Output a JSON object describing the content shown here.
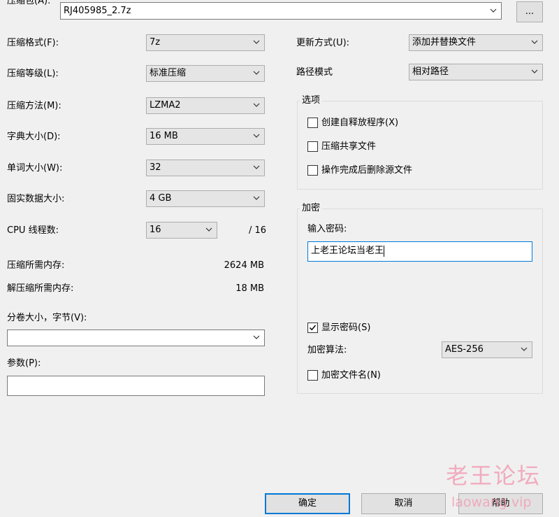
{
  "archive": {
    "label": "压缩包(A):",
    "path": "RJ405985_2.7z",
    "browse_label": "..."
  },
  "left": {
    "format": {
      "label": "压缩格式(F):",
      "value": "7z"
    },
    "level": {
      "label": "压缩等级(L):",
      "value": "标准压缩"
    },
    "method": {
      "label": "压缩方法(M):",
      "value": "LZMA2"
    },
    "dict": {
      "label": "字典大小(D):",
      "value": "16 MB"
    },
    "word": {
      "label": "单词大小(W):",
      "value": "32"
    },
    "solid": {
      "label": "固实数据大小:",
      "value": "4 GB"
    },
    "threads": {
      "label": "CPU 线程数:",
      "value": "16",
      "max": "/ 16"
    },
    "mem_compress": {
      "label": "压缩所需内存:",
      "value": "2624 MB"
    },
    "mem_decompress": {
      "label": "解压缩所需内存:",
      "value": "18 MB"
    },
    "volume": {
      "label": "分卷大小，字节(V):",
      "value": ""
    },
    "params": {
      "label": "参数(P):",
      "value": ""
    }
  },
  "right": {
    "update": {
      "label": "更新方式(U):",
      "value": "添加并替换文件"
    },
    "path_mode": {
      "label": "路径模式",
      "value": "相对路径"
    },
    "options": {
      "title": "选项",
      "sfx": {
        "label": "创建自释放程序(X)",
        "checked": false
      },
      "shared": {
        "label": "压缩共享文件",
        "checked": false
      },
      "delete": {
        "label": "操作完成后删除源文件",
        "checked": false
      }
    },
    "encryption": {
      "title": "加密",
      "password_label": "输入密码:",
      "password_value": "上老王论坛当老王",
      "show_password": {
        "label": "显示密码(S)",
        "checked": true
      },
      "method_label": "加密算法:",
      "method_value": "AES-256",
      "encrypt_names": {
        "label": "加密文件名(N)",
        "checked": false
      }
    }
  },
  "buttons": {
    "ok": "确定",
    "cancel": "取消",
    "help": "帮助"
  },
  "watermark": {
    "line1": "老王论坛",
    "line2": "laowang.vip"
  }
}
